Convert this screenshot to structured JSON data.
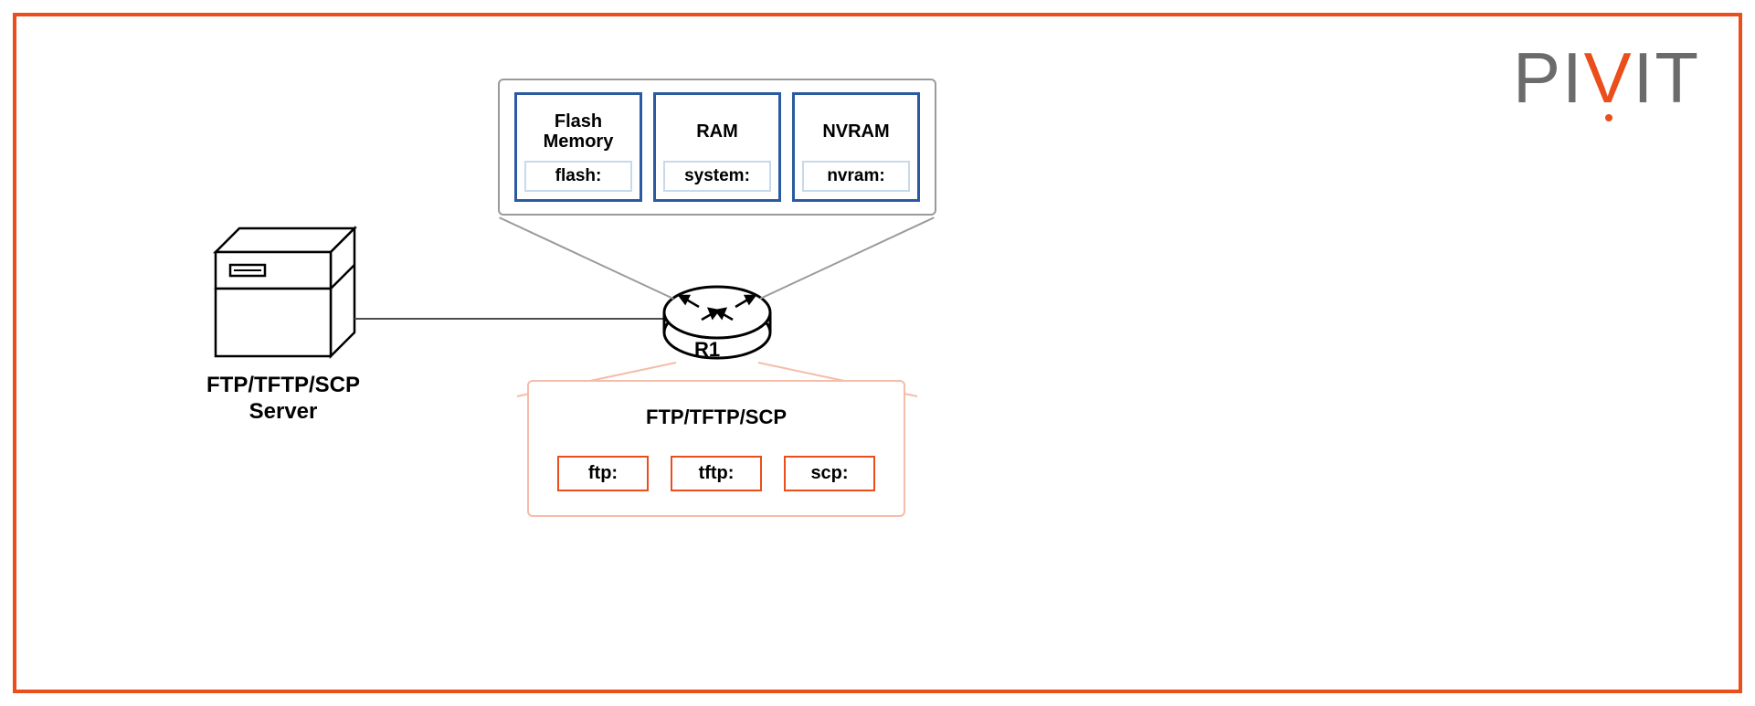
{
  "logo": {
    "p": "P",
    "i1": "I",
    "v": "V",
    "i2": "I",
    "t": "T"
  },
  "server": {
    "label_line1": "FTP/TFTP/SCP",
    "label_line2": "Server"
  },
  "router": {
    "label": "R1"
  },
  "memory": {
    "items": [
      {
        "title": "Flash Memory",
        "sub": "flash:"
      },
      {
        "title": "RAM",
        "sub": "system:"
      },
      {
        "title": "NVRAM",
        "sub": "nvram:"
      }
    ]
  },
  "protocols": {
    "title": "FTP/TFTP/SCP",
    "items": [
      {
        "label": "ftp:"
      },
      {
        "label": "tftp:"
      },
      {
        "label": "scp:"
      }
    ]
  }
}
